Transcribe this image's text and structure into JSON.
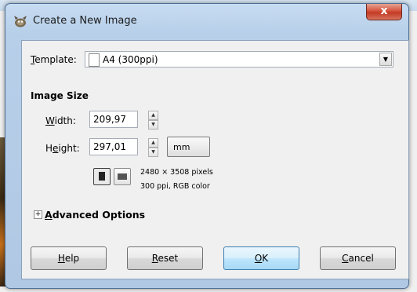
{
  "window": {
    "title": "Create a New Image",
    "close_label": "x"
  },
  "template": {
    "label_accel": "T",
    "label_rest": "emplate:",
    "value": "A4 (300ppi)",
    "dropdown_arrow": "▼"
  },
  "image_size": {
    "heading": "Image Size",
    "width": {
      "label_accel": "W",
      "label_rest": "idth:",
      "value": "209,97"
    },
    "height": {
      "label_pre": "H",
      "label_accel": "e",
      "label_rest": "ight:",
      "value": "297,01"
    },
    "unit": "mm",
    "spin_up": "▲",
    "spin_down": "▼",
    "info_pixels": "2480 × 3508 pixels",
    "info_resolution": "300 ppi, RGB color"
  },
  "advanced": {
    "expander": "+",
    "label_accel": "A",
    "label_rest": "dvanced Options"
  },
  "buttons": {
    "help_accel": "H",
    "help_rest": "elp",
    "reset_accel": "R",
    "reset_rest": "eset",
    "ok_accel": "O",
    "ok_rest": "K",
    "cancel_accel": "C",
    "cancel_rest": "ancel"
  },
  "icons": {
    "app": "gimp-wilber-icon",
    "template_doc": "document-icon",
    "portrait": "portrait-orientation-icon",
    "landscape": "landscape-orientation-icon"
  }
}
